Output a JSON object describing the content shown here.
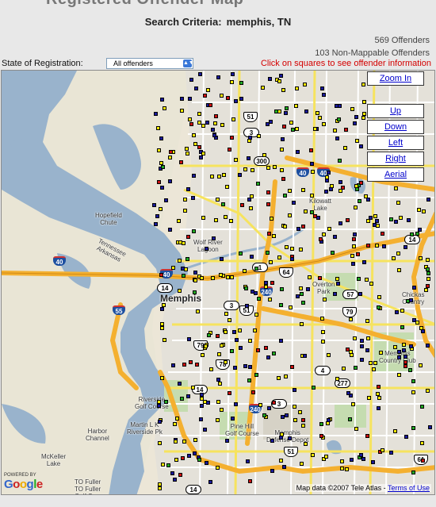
{
  "page": {
    "heading": "Registered Offender Map"
  },
  "search": {
    "label": "Search Criteria:",
    "value": "memphis, TN"
  },
  "counts": {
    "offenders": "569 Offenders",
    "non_mappable": "103 Non-Mappable Offenders"
  },
  "filter": {
    "label": "State of Registration:",
    "selected": "All offenders"
  },
  "hint": "Click on squares to see offender information",
  "map_controls": {
    "zoom_in": "Zoom In",
    "up": "Up",
    "down": "Down",
    "left": "Left",
    "right": "Right",
    "aerial": "Aerial"
  },
  "map": {
    "city": "Memphis",
    "places": {
      "hopefield": "Hopefield\nChute",
      "wolf_river": "Wolf River\nLagoon",
      "kilowatt": "Kilowatt\nLake",
      "overton": "Overton\nPark",
      "chickasaw": "Chickas\nCountry",
      "memphis_cc": "Memphis\nCountry Club",
      "riverside": "Riverside\nGolf Course",
      "martin_luther": "Martin L K\nRiverside Pk",
      "harbor": "Harbor\nChannel",
      "pine_hill": "Pine Hill\nGolf Course",
      "defense_depot": "Memphis\nDefense Depot",
      "mckeller": "McKeller\nLake",
      "fuller": "TO Fuller\nTO Fuller\nGolf Course",
      "tennessee": "Tennessee\nArkansas"
    },
    "shields": [
      "51",
      "3",
      "300",
      "40",
      "40",
      "14",
      "40",
      "40",
      "1",
      "64",
      "57",
      "55",
      "79",
      "51",
      "3",
      "240",
      "14",
      "4",
      "277",
      "240",
      "3",
      "79",
      "14",
      "51",
      "61",
      "14",
      "78"
    ],
    "powered_by": "POWERED BY",
    "google": "Google",
    "attribution": "Map data ©2007 Tele Atlas -",
    "terms": "Terms of Use"
  }
}
